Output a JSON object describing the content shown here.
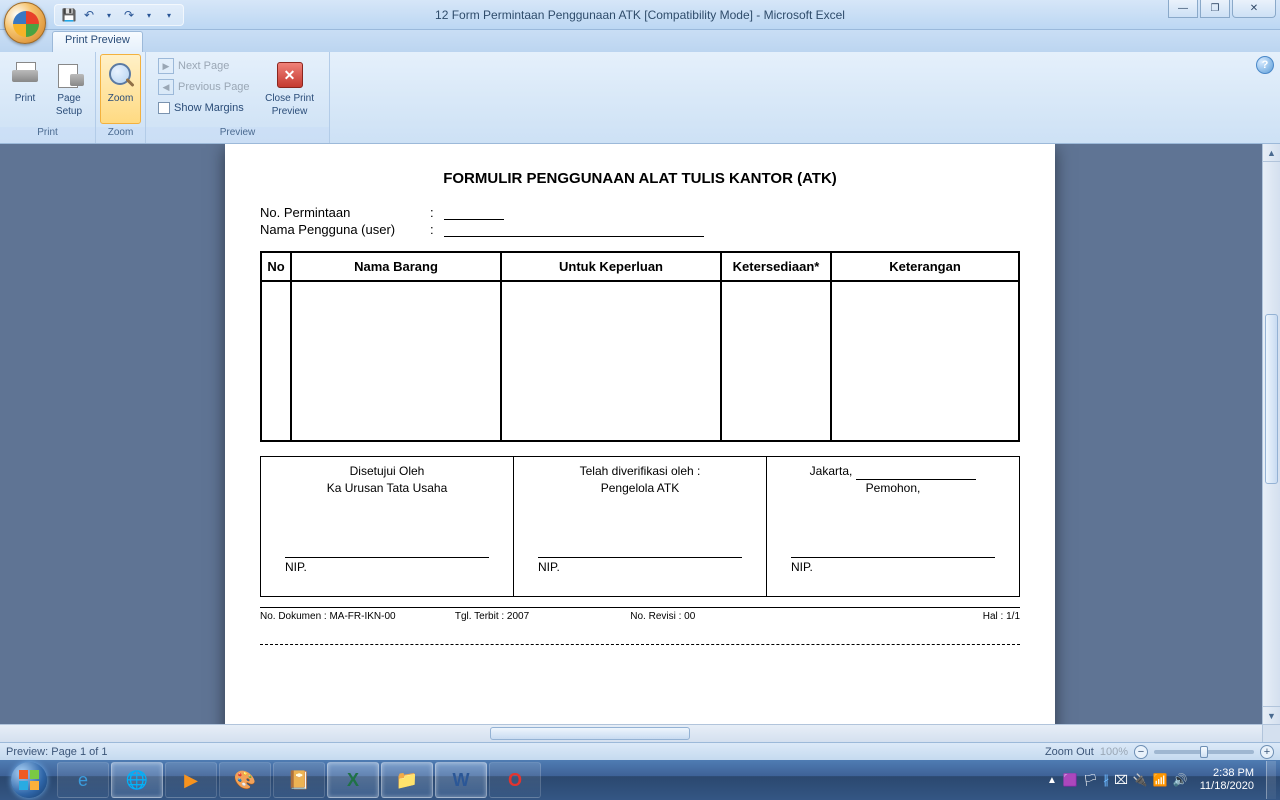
{
  "window": {
    "title": "12 Form Permintaan Penggunaan ATK  [Compatibility Mode] - Microsoft Excel"
  },
  "tabs": {
    "print_preview": "Print Preview"
  },
  "ribbon": {
    "print": "Print",
    "page_setup_l1": "Page",
    "page_setup_l2": "Setup",
    "group_print": "Print",
    "zoom": "Zoom",
    "group_zoom": "Zoom",
    "next_page": "Next Page",
    "previous_page": "Previous Page",
    "show_margins": "Show Margins",
    "close_l1": "Close Print",
    "close_l2": "Preview",
    "group_preview": "Preview"
  },
  "doc": {
    "title": "FORMULIR PENGGUNAAN ALAT TULIS KANTOR (ATK)",
    "field_no": "No. Permintaan",
    "field_user": "Nama Pengguna (user)",
    "th_no": "No",
    "th_nama": "Nama Barang",
    "th_untuk": "Untuk Keperluan",
    "th_ketersediaan": "Ketersediaan*",
    "th_keterangan": "Keterangan",
    "sig1_l1": "Disetujui Oleh",
    "sig1_l2": "Ka Urusan Tata Usaha",
    "sig2_l1": "Telah diverifikasi oleh :",
    "sig2_l2": "Pengelola ATK",
    "sig3_city": "Jakarta,",
    "sig3_l2": "Pemohon,",
    "nip": "NIP.",
    "f_no": "No. Dokumen : MA-FR-IKN-00",
    "f_tgl": "Tgl. Terbit : 2007",
    "f_rev": "No. Revisi  : 00",
    "f_hal": "Hal : 1/1"
  },
  "statusbar": {
    "page": "Preview: Page 1 of 1",
    "zoom_out": "Zoom Out",
    "zoom_pct": "100%"
  },
  "tray": {
    "time": "2:38 PM",
    "date": "11/18/2020"
  }
}
